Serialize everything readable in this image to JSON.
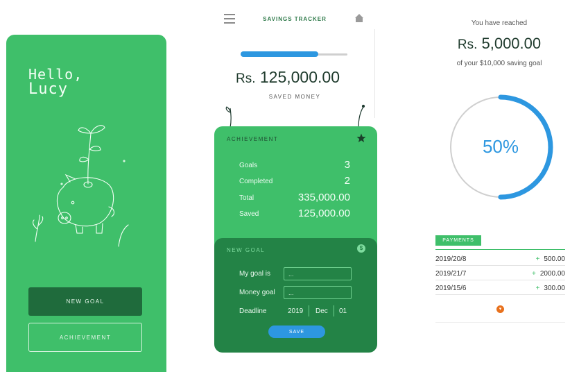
{
  "screen1": {
    "greeting": "Hello,",
    "user_name": "Lucy",
    "new_goal_button": "NEW GOAL",
    "achievement_button": "ACHIEVEMENT"
  },
  "screen2": {
    "title": "SAVINGS TRACKER",
    "progress": 0.73,
    "currency": "Rs.",
    "saved_amount": "125,000.00",
    "saved_label": "SAVED MONEY",
    "achievement": {
      "title": "ACHIEVEMENT",
      "stats": [
        {
          "label": "Goals",
          "value": "3"
        },
        {
          "label": "Completed",
          "value": "2"
        },
        {
          "label": "Total",
          "value": "335,000.00"
        },
        {
          "label": "Saved",
          "value": "125,000.00"
        }
      ]
    },
    "new_goal": {
      "title": "NEW GOAL",
      "goal_label": "My goal is",
      "goal_placeholder": "...",
      "money_label": "Money goal",
      "money_placeholder": "...",
      "deadline_label": "Deadline",
      "deadline_year": "2019",
      "deadline_month": "Dec",
      "deadline_day": "01",
      "save_button": "SAVE"
    }
  },
  "screen3": {
    "reached_label": "You have reached",
    "currency": "Rs.",
    "reached_amount": "5,000.00",
    "goal_text": "of your $10,000 saving goal",
    "percent": 50,
    "percent_text": "50%",
    "payments_tab": "PAYMENTS",
    "payments": [
      {
        "date": "2019/20/8",
        "amount": "500.00"
      },
      {
        "date": "2019/21/7",
        "amount": "2000.00"
      },
      {
        "date": "2019/15/6",
        "amount": "300.00"
      }
    ]
  },
  "colors": {
    "green": "#3fbf6a",
    "dark_green": "#238346",
    "blue": "#2d97e0",
    "orange": "#e8711d"
  }
}
